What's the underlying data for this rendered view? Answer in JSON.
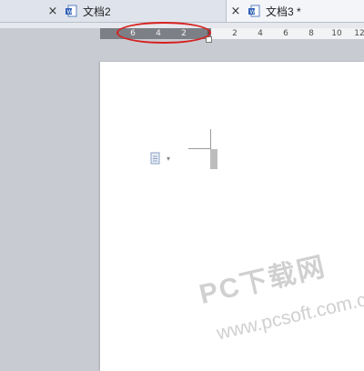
{
  "tabs": [
    {
      "label": "文档2",
      "close": "×"
    },
    {
      "label": "文档3 *",
      "close": "×"
    }
  ],
  "ruler": {
    "left_numbers": [
      "6",
      "4",
      "2"
    ],
    "right_numbers": [
      "2",
      "4",
      "6",
      "8",
      "10",
      "12"
    ]
  },
  "page": {
    "paste_caret": "▾"
  },
  "watermark": {
    "main": "PC下载网",
    "url": "www.pcsoft.com.cn"
  },
  "colors": {
    "highlight": "#d6201f",
    "ruler_margin": "#7d7f86",
    "tab_bar": "#dfe4ec"
  }
}
